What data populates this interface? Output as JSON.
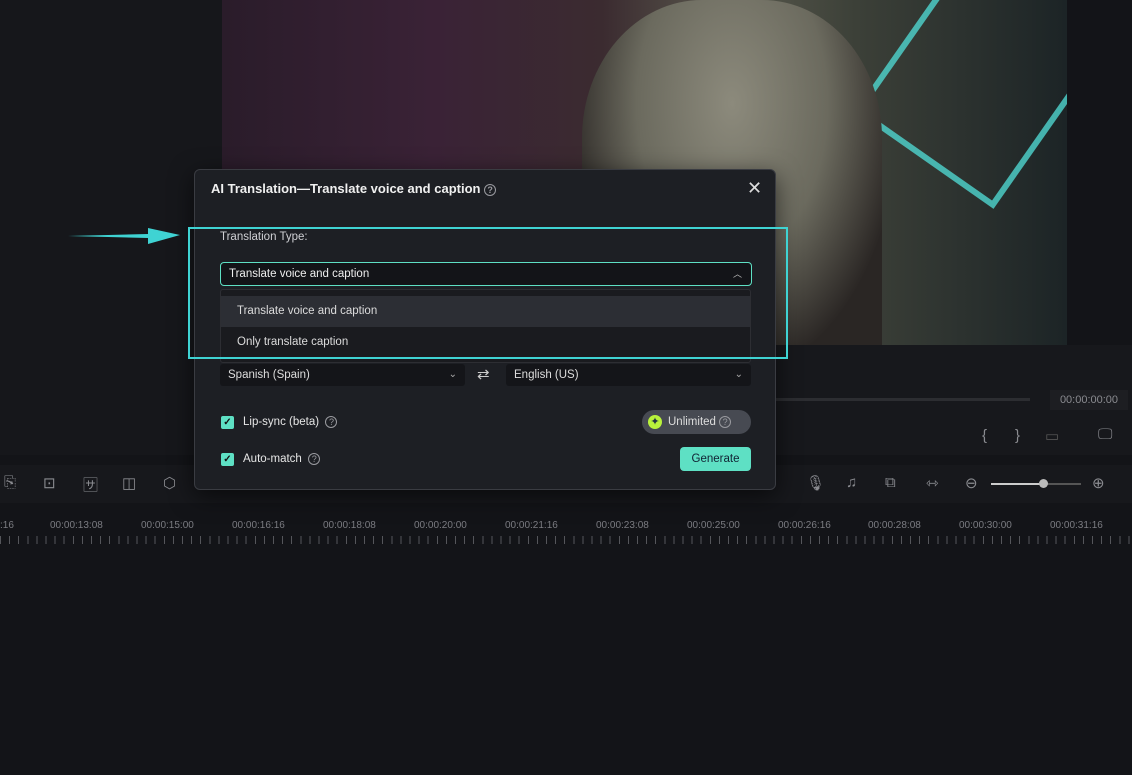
{
  "dialog": {
    "title": "AI Translation—Translate voice and caption",
    "translation_type_label": "Translation Type:",
    "translation_type_value": "Translate voice and caption",
    "options": [
      "Translate voice and caption",
      "Only translate caption"
    ],
    "source_language": "Spanish (Spain)",
    "target_language": "English (US)",
    "lip_sync_label": "Lip-sync (beta)",
    "lip_sync_checked": true,
    "auto_match_label": "Auto-match",
    "auto_match_checked": true,
    "credits_label": "Unlimited",
    "generate_label": "Generate"
  },
  "player": {
    "timecode": "00:00:00:00"
  },
  "timeline": {
    "ticks": [
      ":16",
      "00:00:13:08",
      "00:00:15:00",
      "00:00:16:16",
      "00:00:18:08",
      "00:00:20:00",
      "00:00:21:16",
      "00:00:23:08",
      "00:00:25:00",
      "00:00:26:16",
      "00:00:28:08",
      "00:00:30:00",
      "00:00:31:16"
    ]
  },
  "colors": {
    "accent": "#5ee0c4",
    "highlight": "#3fd3d3",
    "credit_icon": "#b9f23c"
  }
}
